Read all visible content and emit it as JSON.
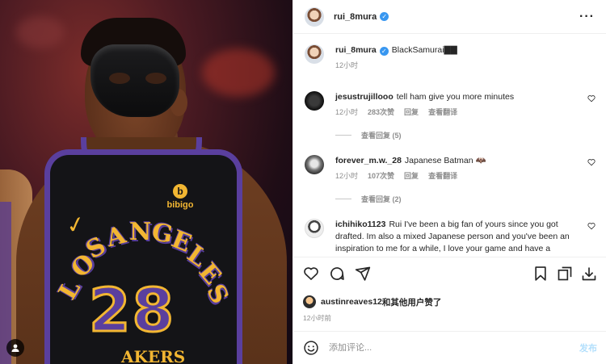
{
  "post": {
    "author": "rui_8mura",
    "verified_icon": "verified-badge-icon",
    "more_icon": "more-horizontal-icon"
  },
  "caption": {
    "author": "rui_8mura",
    "text": "BlackSamurai▇▇",
    "time": "12小时"
  },
  "comments": [
    {
      "user": "jesustrujillooo",
      "text": "tell ham give you more minutes",
      "time": "12小时",
      "likes": "283次赞",
      "reply": "回复",
      "translate": "查看翻译",
      "view_replies": "查看回复 (5)"
    },
    {
      "user": "forever_m.w._28",
      "text": "Japanese Batman 🦇",
      "time": "12小时",
      "likes": "107次赞",
      "reply": "回复",
      "translate": "查看翻译",
      "view_replies": "查看回复 (2)"
    },
    {
      "user": "ichihiko1123",
      "text": "Rui I've been a big fan of yours since you got drafted. Im also a mixed Japanese person and you've been an inspiration to me for a while, I love your game and have a"
    }
  ],
  "actions": {
    "like_icon": "heart-icon",
    "comment_icon": "comment-icon",
    "share_icon": "send-icon",
    "save_icon": "bookmark-icon",
    "copy_icon": "copy-icon",
    "download_icon": "download-icon"
  },
  "likes": {
    "user": "austinreaves12",
    "suffix": "和其他用户赞了"
  },
  "post_time": "12小时前",
  "add_comment": {
    "placeholder": "添加评论...",
    "post_label": "发布",
    "emoji_icon": "smiley-icon"
  },
  "photo": {
    "jersey_city_letters": [
      "L",
      "O",
      "S",
      "A",
      "N",
      "G",
      "E",
      "L",
      "E",
      "S"
    ],
    "jersey_number": "28",
    "sponsor": "bibigo",
    "bottom_text": "AKERS"
  },
  "colors": {
    "verified": "#3897f0",
    "muted": "#8e8e8e",
    "post_button_disabled": "#b2dffc",
    "lakers_purple": "#5a3f9e",
    "lakers_gold": "#f2b632"
  }
}
